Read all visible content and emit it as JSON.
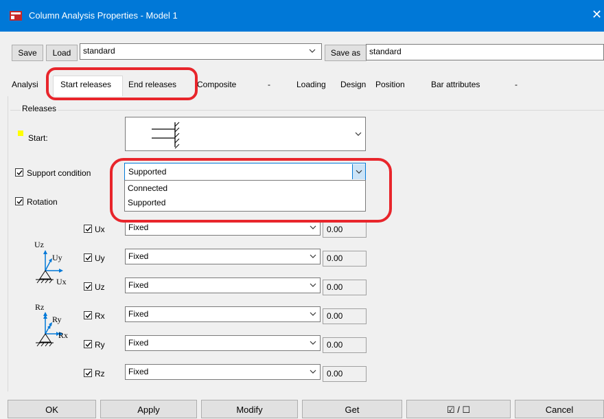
{
  "window": {
    "title": "Column Analysis Properties - Model 1",
    "close_glyph": "✕",
    "icon": "app-icon"
  },
  "toolbar": {
    "save_label": "Save",
    "load_label": "Load",
    "preset_value": "standard",
    "save_as_label": "Save as",
    "save_as_value": "standard"
  },
  "tabs": [
    "Analysi",
    "Start releases",
    "End releases",
    "Composite",
    "-",
    "Loading",
    "Design",
    "Position",
    "Bar attributes",
    "-"
  ],
  "group": {
    "title": "Releases"
  },
  "start": {
    "label": "Start:"
  },
  "support": {
    "label": "Support condition",
    "value": "Supported",
    "checked": true
  },
  "support_options": [
    "Connected",
    "Supported"
  ],
  "rotation": {
    "label": "Rotation",
    "checked": true
  },
  "translation_axes": {
    "z": "Uz",
    "y": "Uy",
    "x": "Ux"
  },
  "rotation_axes": {
    "z": "Rz",
    "y": "Ry",
    "x": "Rx"
  },
  "releases": [
    {
      "label": "Ux",
      "checked": true,
      "value": "Fixed",
      "number": "0.00"
    },
    {
      "label": "Uy",
      "checked": true,
      "value": "Fixed",
      "number": "0.00"
    },
    {
      "label": "Uz",
      "checked": true,
      "value": "Fixed",
      "number": "0.00"
    },
    {
      "label": "Rx",
      "checked": true,
      "value": "Fixed",
      "number": "0.00"
    },
    {
      "label": "Ry",
      "checked": true,
      "value": "Fixed",
      "number": "0.00"
    },
    {
      "label": "Rz",
      "checked": true,
      "value": "Fixed",
      "number": "0.00"
    }
  ],
  "buttons": {
    "ok": "OK",
    "apply": "Apply",
    "modify": "Modify",
    "get": "Get",
    "toggle": "☑ / ☐",
    "cancel": "Cancel"
  },
  "colors": {
    "titlebar": "#0078d7",
    "highlight": "#e8252b",
    "start_marker": "#ffff00",
    "focus": "#0078d7"
  }
}
